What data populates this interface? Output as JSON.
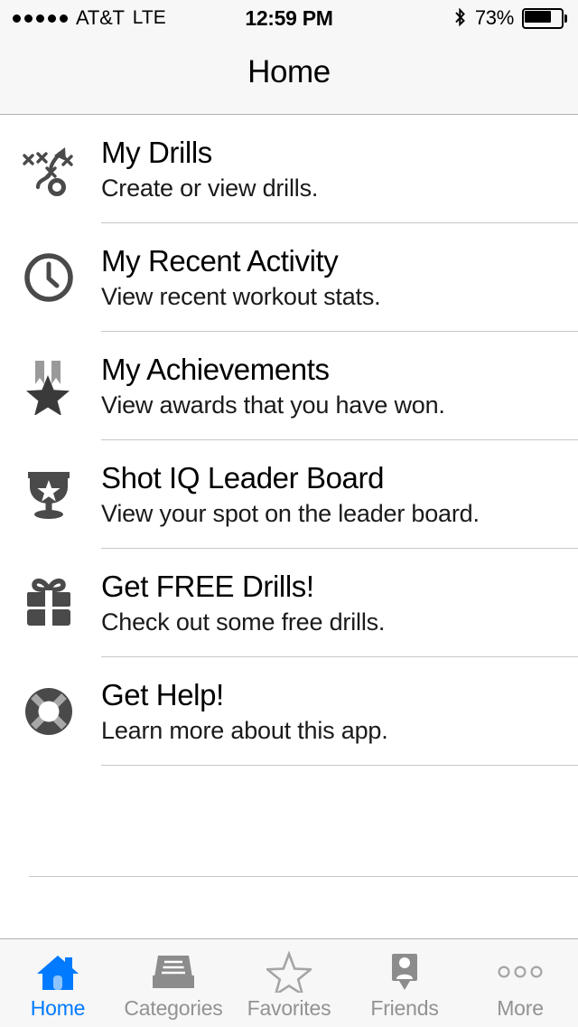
{
  "status_bar": {
    "signal_dots": 5,
    "carrier": "AT&T",
    "network": "LTE",
    "time": "12:59 PM",
    "bluetooth_icon": "bluetooth-icon",
    "battery_percent": "73%",
    "battery_level": 73
  },
  "nav_bar": {
    "title": "Home"
  },
  "list": {
    "items": [
      {
        "icon": "playbook-drills-icon",
        "title": "My Drills",
        "subtitle": "Create or view drills."
      },
      {
        "icon": "clock-icon",
        "title": "My Recent Activity",
        "subtitle": "View recent workout stats."
      },
      {
        "icon": "medal-star-icon",
        "title": "My Achievements",
        "subtitle": "View awards that you have won."
      },
      {
        "icon": "trophy-icon",
        "title": "Shot IQ Leader Board",
        "subtitle": "View your spot on the leader board."
      },
      {
        "icon": "gift-icon",
        "title": "Get FREE Drills!",
        "subtitle": "Check out some free drills."
      },
      {
        "icon": "lifebuoy-icon",
        "title": "Get Help!",
        "subtitle": "Learn more about this app."
      }
    ]
  },
  "tab_bar": {
    "active_index": 0,
    "active_color": "#007aff",
    "inactive_color": "#929292",
    "tabs": [
      {
        "icon": "house-icon",
        "label": "Home"
      },
      {
        "icon": "file-tray-icon",
        "label": "Categories"
      },
      {
        "icon": "star-outline-icon",
        "label": "Favorites"
      },
      {
        "icon": "person-badge-icon",
        "label": "Friends"
      },
      {
        "icon": "ellipsis-icon",
        "label": "More"
      }
    ]
  },
  "colors": {
    "chrome_background": "#f7f7f7",
    "content_background": "#ffffff",
    "separator": "#c8c7cc",
    "icon_dark": "#4a4a4a",
    "icon_light": "#9a9a9a",
    "text_primary": "#000000"
  }
}
